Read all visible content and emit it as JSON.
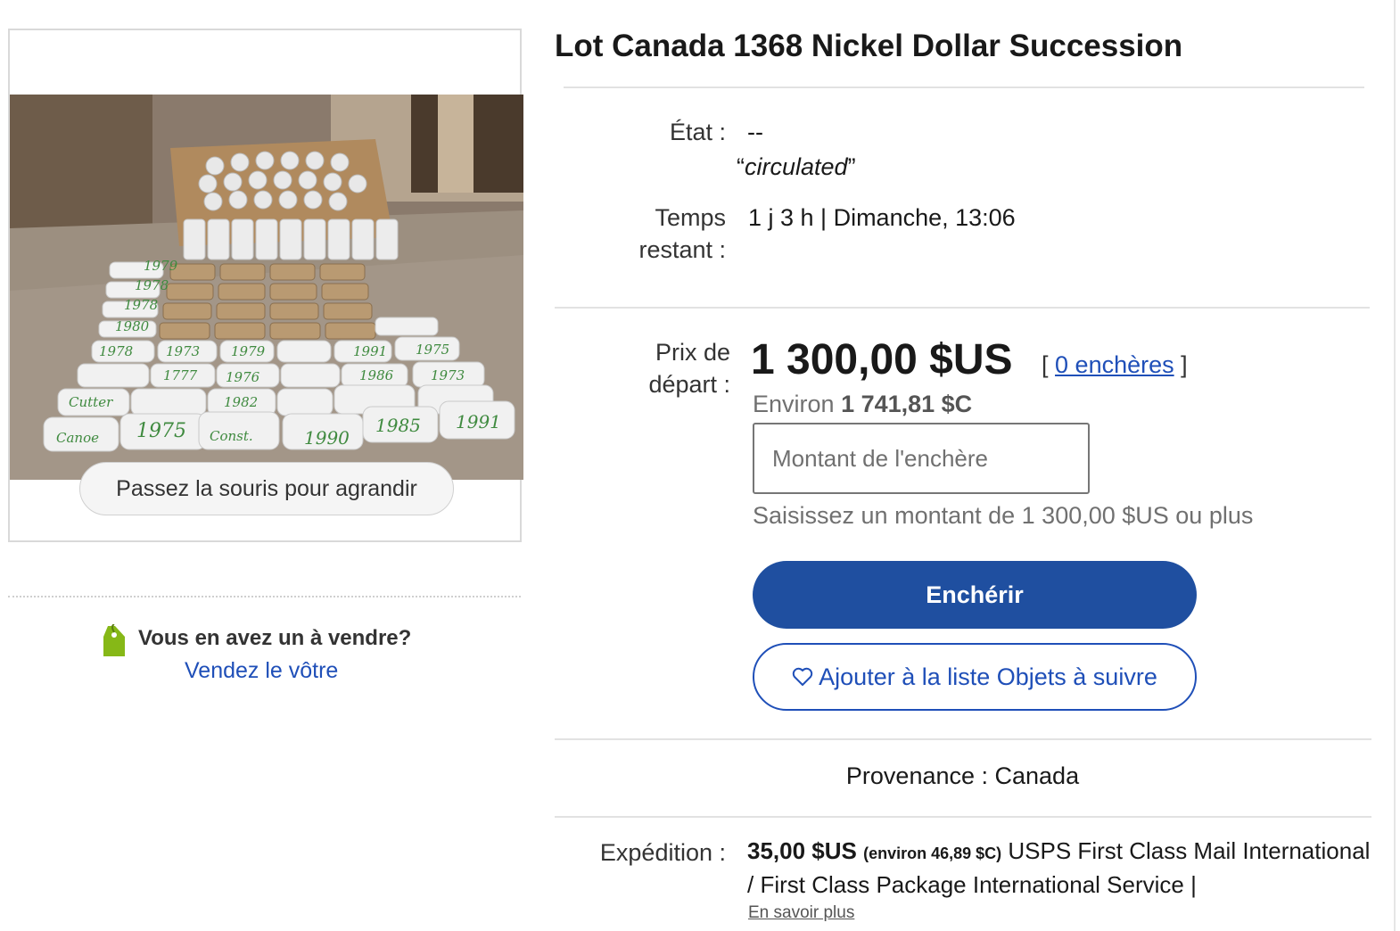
{
  "image": {
    "hover_hint": "Passez la souris pour agrandir",
    "roll_labels": [
      "1979",
      "1978",
      "1978",
      "1980",
      "1978",
      "1973",
      "1979",
      "1975",
      "1991",
      "1777",
      "1976",
      "1986",
      "1973",
      "Cutter",
      "1975",
      "1982",
      "Canoe",
      "Const.",
      "1990",
      "1985",
      "1991"
    ]
  },
  "sell": {
    "question": "Vous en avez un à vendre?",
    "link": "Vendez le vôtre"
  },
  "listing": {
    "title": "Lot Canada 1368 Nickel Dollar Succession",
    "condition_label": "État :",
    "condition_value": "--",
    "condition_note": "circulated",
    "time_label_1": "Temps",
    "time_label_2": "restant :",
    "time_value": "1 j 3 h | Dimanche, 13:06",
    "price_label_1": "Prix de",
    "price_label_2": "départ :",
    "price": "1 300,00 $US",
    "bids_open": "[",
    "bids_link": "0 enchères",
    "bids_close": "]",
    "approx_prefix": "Environ",
    "approx_value": "1 741,81 $C",
    "bid_placeholder": "Montant de l'enchère",
    "bid_hint": "Saisissez un montant de 1 300,00 $US ou plus",
    "bid_button": "Enchérir",
    "watch_button": "Ajouter à la liste Objets à suivre",
    "origin": "Provenance : Canada",
    "shipping_label": "Expédition :",
    "shipping_amount": "35,00 $US",
    "shipping_approx": "(environ 46,89 $C)",
    "shipping_service": "USPS First Class Mail International / First Class Package International Service |",
    "learn_more": "En savoir plus"
  },
  "colors": {
    "primary_button": "#1f4fa0",
    "link": "#1f4fb8",
    "tag_icon": "#86b817"
  }
}
